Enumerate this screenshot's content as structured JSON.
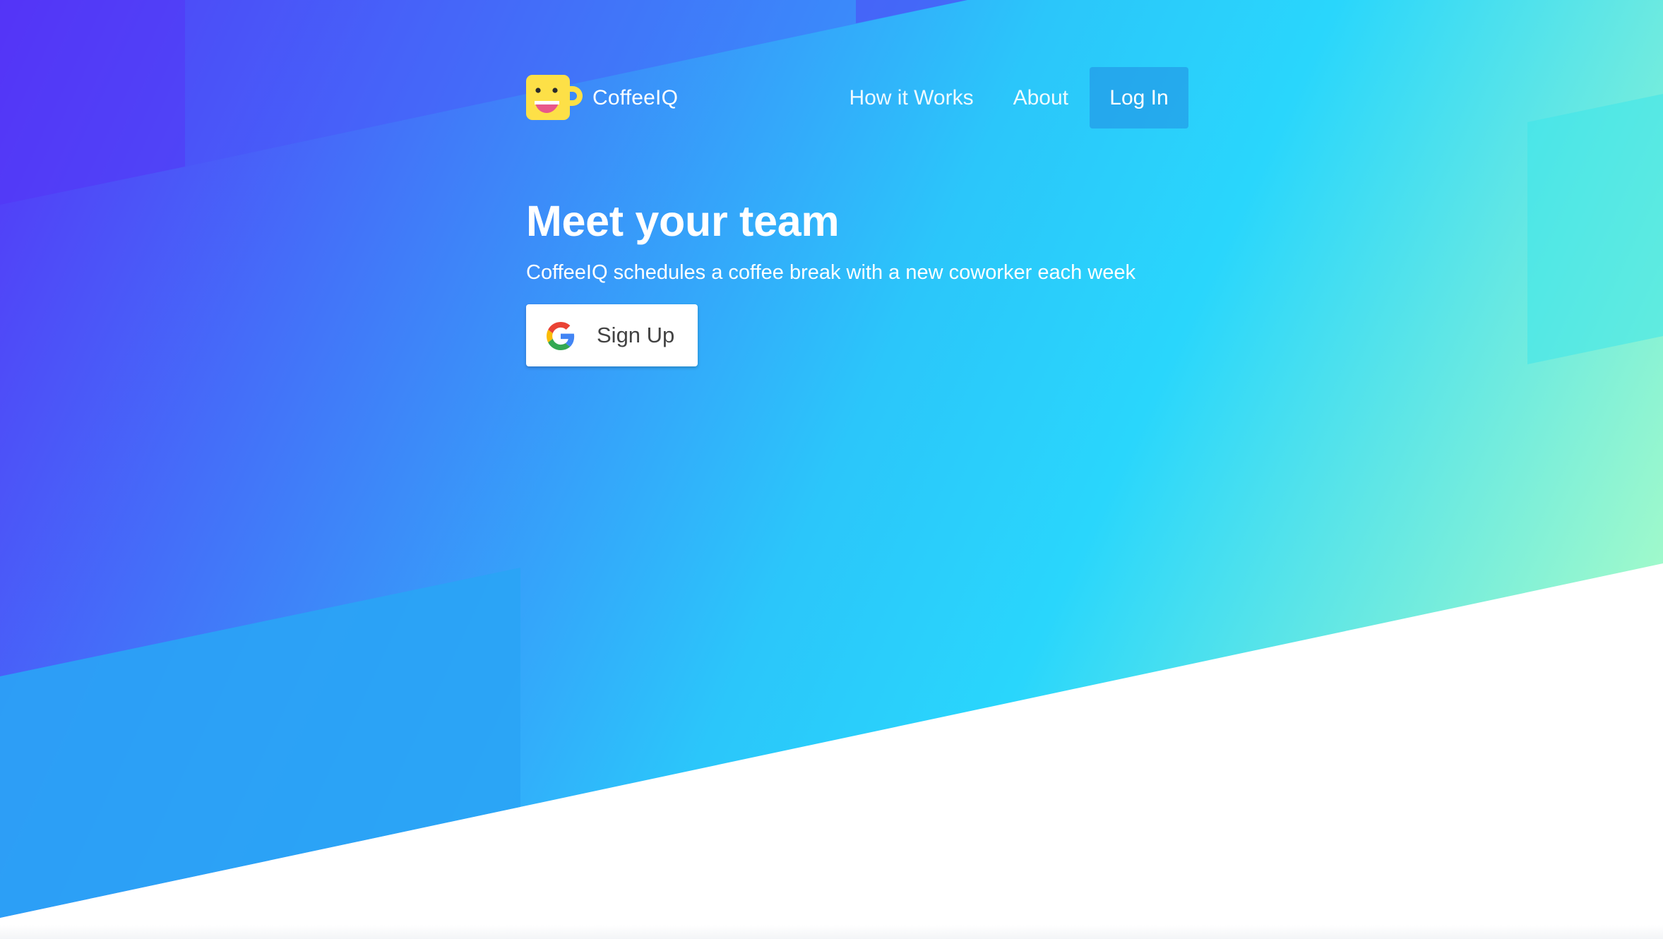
{
  "brand": {
    "name": "CoffeeIQ",
    "logo_icon": "smiling-coffee-mug-icon"
  },
  "nav": {
    "items": [
      {
        "label": "How it Works"
      },
      {
        "label": "About"
      }
    ],
    "login_label": "Log In"
  },
  "hero": {
    "title": "Meet your team",
    "subtitle": "CoffeeIQ schedules a coffee break with a new coworker each week",
    "signup_label": "Sign Up",
    "signup_icon": "google-icon"
  },
  "colors": {
    "gradient_start": "#5534f8",
    "gradient_mid": "#29d3fc",
    "gradient_end": "#a8ffc8",
    "mug_yellow": "#fde047",
    "login_bg": "#3a8ee0"
  }
}
